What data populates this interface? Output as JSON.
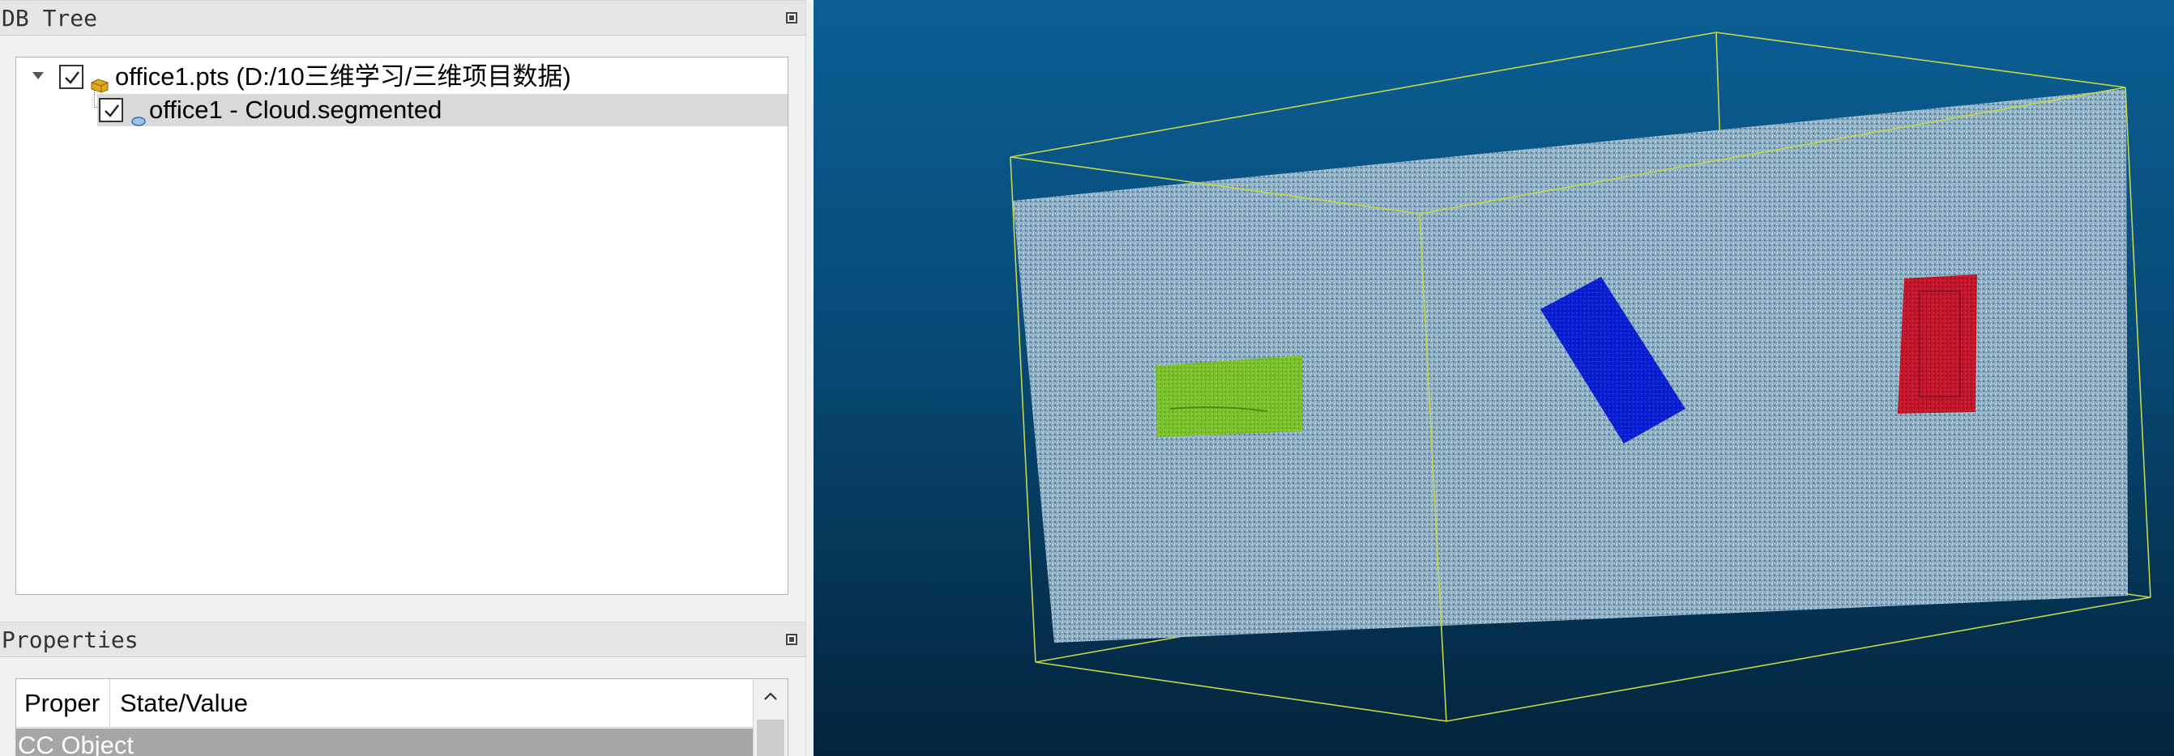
{
  "db_tree": {
    "title": "DB Tree",
    "items": [
      {
        "label": "office1.pts (D:/10三维学习/三维项目数据)",
        "checked": true,
        "icon": "folder-db-icon",
        "expanded": true
      },
      {
        "label": "office1 - Cloud.segmented",
        "checked": true,
        "icon": "point-cloud-icon",
        "selected": true
      }
    ]
  },
  "properties": {
    "title": "Properties",
    "columns": [
      "Proper",
      "State/Value"
    ],
    "group": "CC Object"
  },
  "viewport": {
    "background_top": "#0b5f94",
    "background_bottom": "#03243c",
    "bounding_box_color": "#c8d84a",
    "cloud_color": "#8fb0c4",
    "segments": [
      {
        "name": "green-segment",
        "color": "#7ac02a"
      },
      {
        "name": "blue-segment",
        "color": "#0a20d8"
      },
      {
        "name": "red-segment",
        "color": "#c8182a"
      }
    ]
  }
}
